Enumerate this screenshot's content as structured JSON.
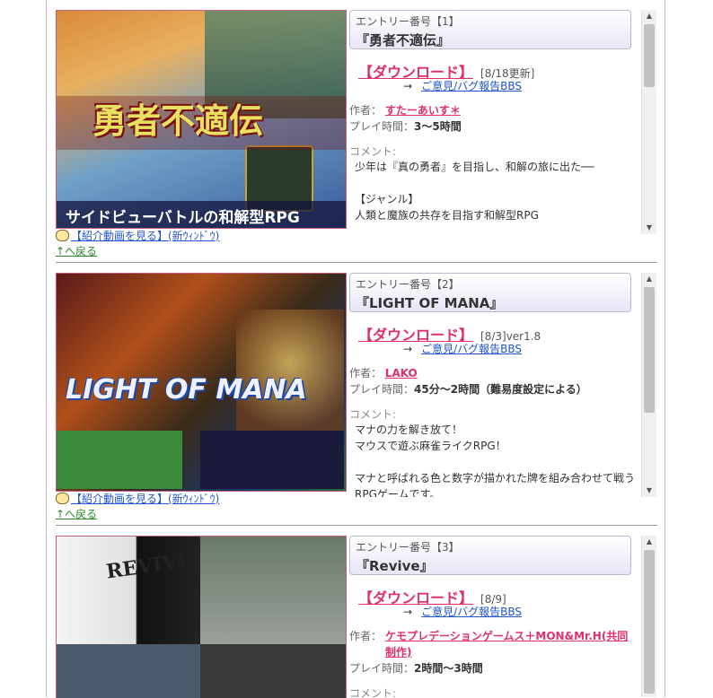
{
  "entries": [
    {
      "entry_no": "エントリー番号【1】",
      "title": "『勇者不適伝』",
      "download": "【ダウンロード】",
      "update": "[8/18更新]",
      "arrow": "→",
      "bbs": "ご意見/バグ報告BBS",
      "author_label": "作者：",
      "author": "すたーあいす＊",
      "play_label": "プレイ時間：",
      "play_time": "3～5時間",
      "comment_label": "コメント:",
      "comment": "少年は『真の勇者』を目指し、和解の旅に出た──\n\n【ジャンル】\n人類と魔族の共存を目指す和解型RPG",
      "video_link": "【紹介動画を見る】(新ｳｨﾝﾄﾞｳ)",
      "back_link": "↑へ戻る",
      "logo": "勇者不適伝",
      "tagline": "サイドビューバトルの和解型RPG"
    },
    {
      "entry_no": "エントリー番号【2】",
      "title": "『LIGHT OF MANA』",
      "download": "【ダウンロード】",
      "update": "[8/3]ver1.8",
      "arrow": "→",
      "bbs": "ご意見/バグ報告BBS",
      "author_label": "作者：",
      "author": "LAKO",
      "play_label": "プレイ時間：",
      "play_time": "45分～2時間（難易度設定による）",
      "comment_label": "コメント:",
      "comment": "マナの力を解き放て！\nマウスで遊ぶ麻雀ライクRPG！\n\nマナと呼ばれる色と数字が描かれた牌を組み合わせて戦う\nRPGゲームです。",
      "video_link": "【紹介動画を見る】(新ｳｨﾝﾄﾞｳ)",
      "back_link": "↑へ戻る",
      "logo": "LIGHT OF MANA"
    },
    {
      "entry_no": "エントリー番号【3】",
      "title": "『Revive』",
      "download": "【ダウンロード】",
      "update": "[8/9]",
      "arrow": "→",
      "bbs": "ご意見/バグ報告BBS",
      "author_label": "作者：",
      "author": "ケモプレデーションゲームス＋MON&Mr.H(共同制作)",
      "play_label": "プレイ時間：",
      "play_time": "2時間～3時間",
      "comment_label": "コメント:",
      "logo": "REVIVE"
    }
  ],
  "colors": {
    "accent": "#e0306a",
    "link": "#2255cc",
    "back": "#2a8a2a"
  }
}
